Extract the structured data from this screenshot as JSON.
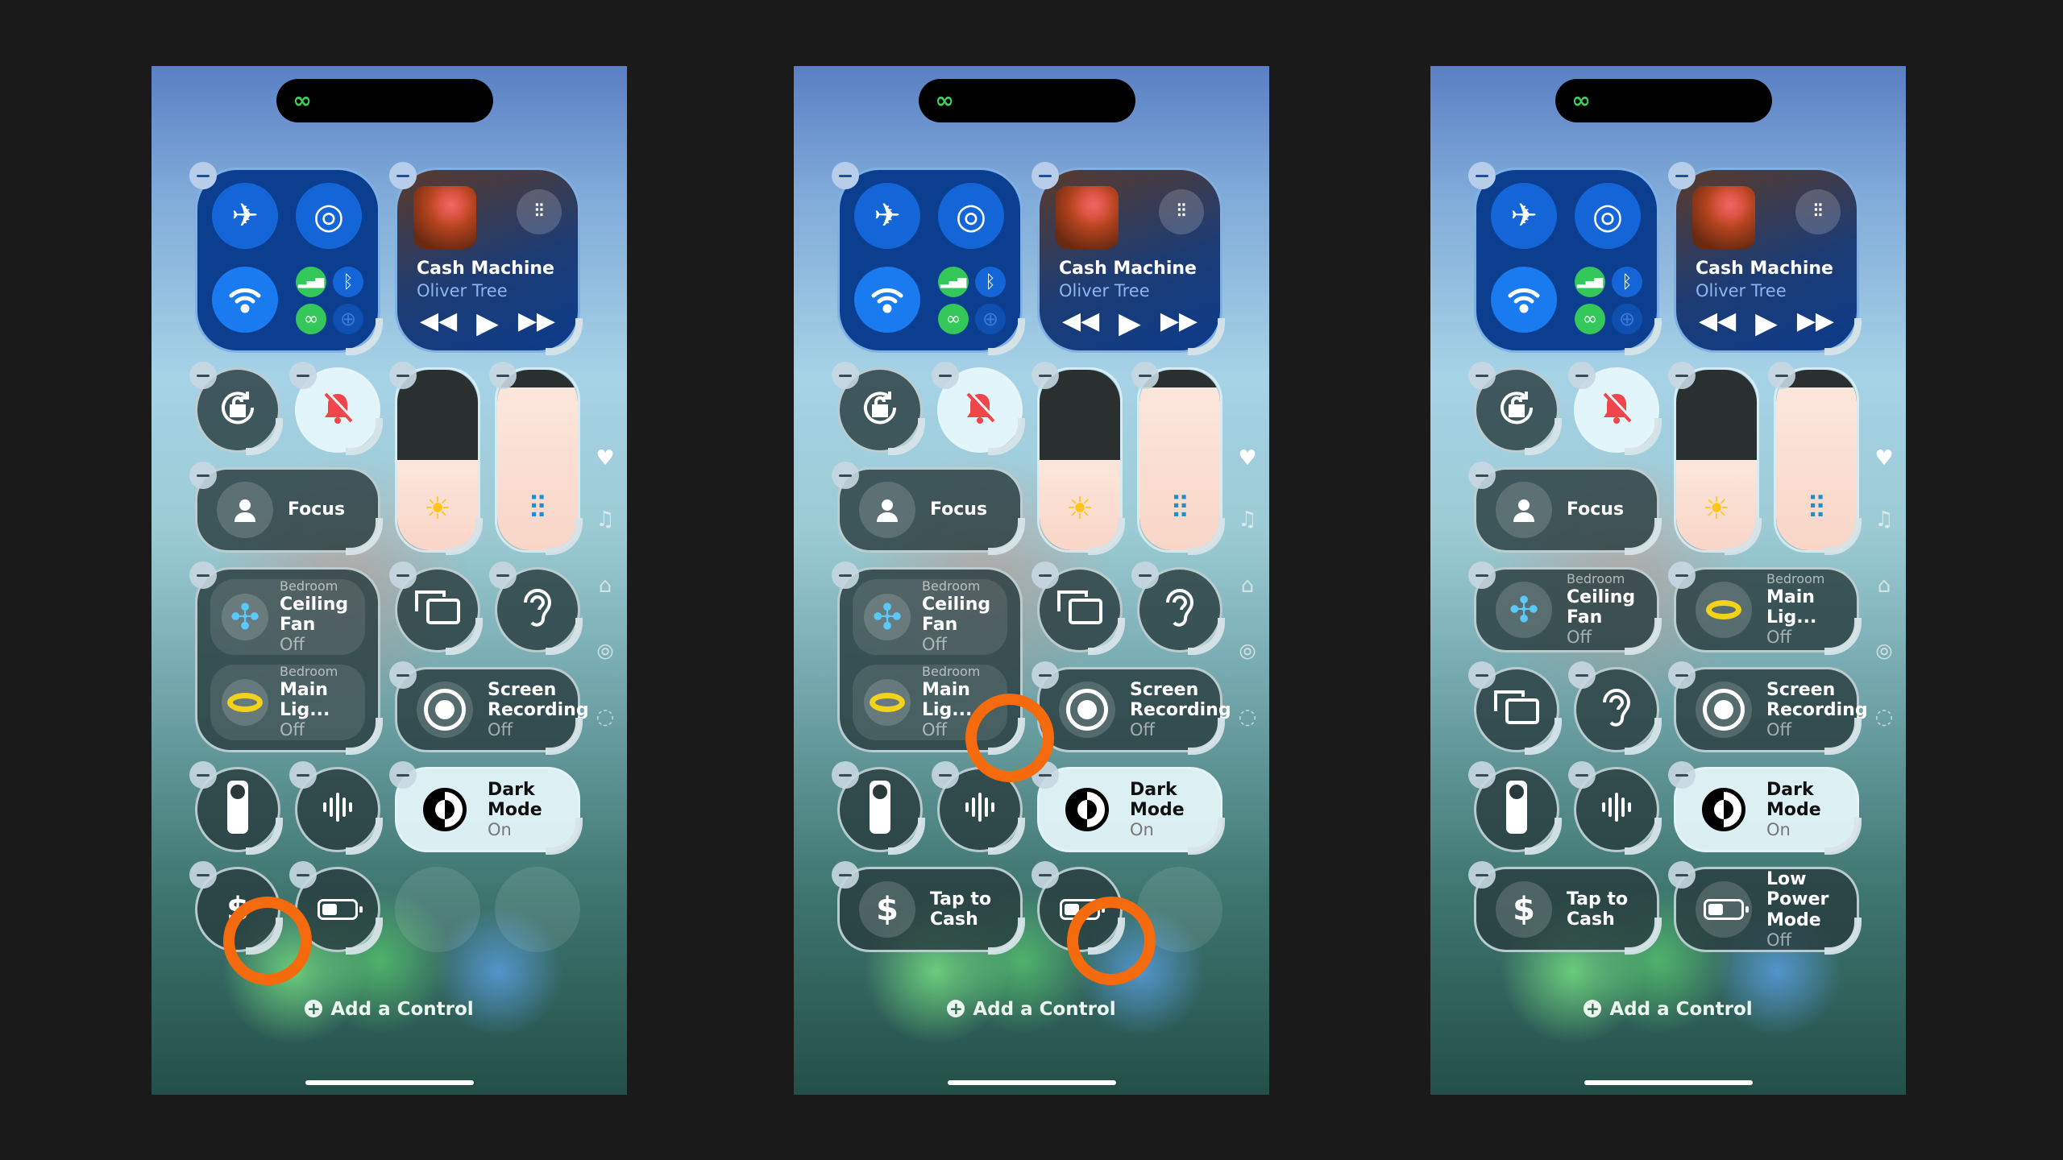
{
  "colors": {
    "background": "#1a1a1a",
    "highlight_ring": "#f56a0c",
    "accent_blue": "#1466d8",
    "accent_green": "#34c759",
    "mute_red": "#f0454a"
  },
  "controls": {
    "connectivity": {
      "icons": [
        "airplane-icon",
        "airdrop-icon",
        "wifi-icon",
        "cellular-icon",
        "bluetooth-icon",
        "hotspot-icon",
        "vpn-icon"
      ]
    },
    "media": {
      "title": "Cash Machine",
      "artist": "Oliver Tree",
      "icons": [
        "album-art",
        "airpods-icon",
        "rewind-icon",
        "play-icon",
        "fast-forward-icon"
      ]
    },
    "orientation": {
      "icon": "orientation-lock-icon"
    },
    "mute": {
      "icon": "bell-slash-icon"
    },
    "brightness": {
      "icon": "sun-icon",
      "level": 0.5
    },
    "volume": {
      "icon": "airpods-icon",
      "level": 0.9
    },
    "focus": {
      "label": "Focus",
      "icon": "person-icon"
    },
    "fan": {
      "room": "Bedroom",
      "label": "Ceiling Fan",
      "status": "Off",
      "icon": "ceiling-fan-icon"
    },
    "light": {
      "room": "Bedroom",
      "label": "Main Lig...",
      "status": "Off",
      "icon": "ceiling-light-icon"
    },
    "mirror": {
      "icon": "screen-mirroring-icon"
    },
    "hearing": {
      "icon": "ear-icon"
    },
    "screenrec": {
      "label": "Screen Recording",
      "status": "Off",
      "icon": "record-icon"
    },
    "remote": {
      "icon": "remote-icon"
    },
    "voice": {
      "icon": "waveform-icon"
    },
    "darkmode": {
      "label": "Dark Mode",
      "status": "On",
      "icon": "dark-mode-icon"
    },
    "tapcash": {
      "label": "Tap to Cash",
      "icon": "dollar-icon"
    },
    "lowpower": {
      "label": "Low Power Mode",
      "status": "Off",
      "icon": "battery-icon"
    }
  },
  "side_icons": [
    "heart-icon",
    "music-icon",
    "home-icon",
    "antenna-icon",
    "dashed-circle-icon"
  ],
  "phones": [
    {
      "add_control": "Add a Control",
      "status_icon": "link-icon"
    },
    {
      "add_control": "Add a Control",
      "status_icon": "link-icon"
    },
    {
      "add_control": "Add a Control",
      "status_icon": "link-icon"
    }
  ]
}
